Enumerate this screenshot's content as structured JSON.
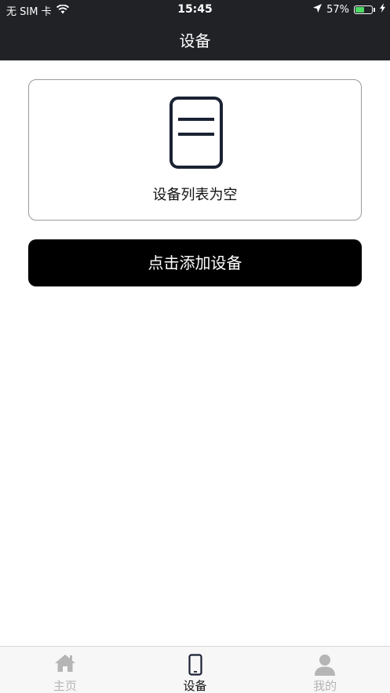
{
  "status_bar": {
    "carrier": "无 SIM 卡",
    "time": "15:45",
    "battery_percent": "57%",
    "battery_level": 0.57
  },
  "nav": {
    "title": "设备"
  },
  "empty_state": {
    "icon": "device-icon",
    "message": "设备列表为空"
  },
  "actions": {
    "add_device_label": "点击添加设备"
  },
  "tabbar": {
    "tabs": [
      {
        "label": "主页",
        "icon": "home-icon",
        "active": false
      },
      {
        "label": "设备",
        "icon": "phone-icon",
        "active": true
      },
      {
        "label": "我的",
        "icon": "person-icon",
        "active": false
      }
    ]
  },
  "colors": {
    "nav_background": "#212226",
    "primary_button": "#000000",
    "battery_green": "#4cd964",
    "tab_inactive": "#b5b5b5",
    "icon_dark": "#1a2233"
  }
}
